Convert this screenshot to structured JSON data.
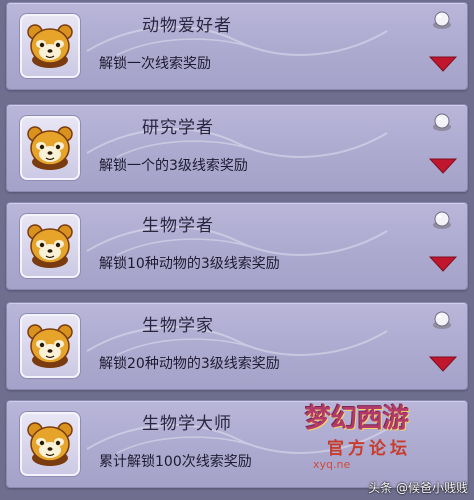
{
  "achievements": [
    {
      "title": "动物爱好者",
      "description": "解锁一次线索奖励",
      "icon": "red-panda-icon"
    },
    {
      "title": "研究学者",
      "description": "解锁一个的3级线索奖励",
      "icon": "red-panda-icon"
    },
    {
      "title": "生物学者",
      "description": "解锁10种动物的3级线索奖励",
      "icon": "red-panda-icon"
    },
    {
      "title": "生物学家",
      "description": "解锁20种动物的3级线索奖励",
      "icon": "red-panda-icon"
    },
    {
      "title": "生物学大师",
      "description": "累计解锁100次线索奖励",
      "icon": "red-panda-icon"
    }
  ],
  "watermark": {
    "logo": "梦幻西游",
    "subtitle": "官方论坛",
    "url": "xyq.ne"
  },
  "credit": "头条 @候爸小贱贱",
  "colors": {
    "card": "#b1aed3",
    "background": "#6f6e8f",
    "expand_arrow": "#c0162e"
  }
}
